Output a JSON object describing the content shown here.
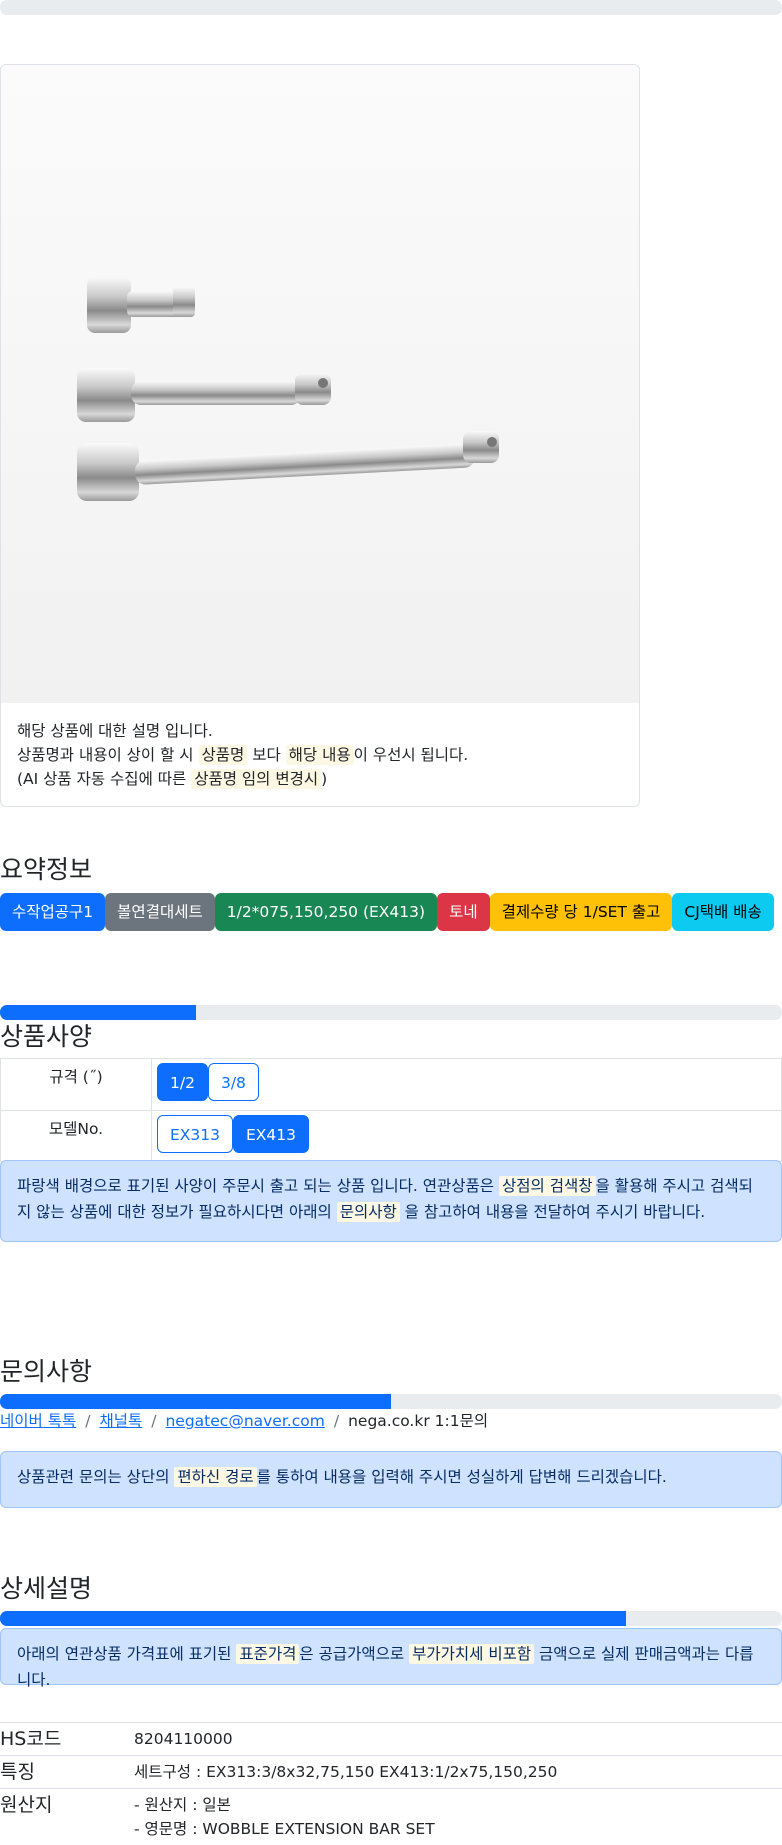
{
  "top_progress": {
    "fill_fraction": 0.0
  },
  "product_card": {
    "image_alt": "wobble extension bar set photo",
    "desc_line1": "해당 상품에 대한 설명 입니다.",
    "desc_line2_a": "상품명과 내용이 상이 할 시 ",
    "desc_line2_mark1": "상품명",
    "desc_line2_b": " 보다 ",
    "desc_line2_mark2": "해당 내용",
    "desc_line2_c": "이 우선시 됩니다.",
    "desc_line3_a": "(AI 상품 자동 수집에 따른 ",
    "desc_line3_mark": "상품명 임의 변경시",
    "desc_line3_b": ")"
  },
  "summary": {
    "title": "요약정보",
    "badges": [
      {
        "label": "수작업공구1",
        "bg": "#0d6efd",
        "fg": "#ffffff"
      },
      {
        "label": "볼연결대세트",
        "bg": "#6c757d",
        "fg": "#ffffff"
      },
      {
        "label": "1/2*075,150,250 (EX413)",
        "bg": "#198754",
        "fg": "#ffffff"
      },
      {
        "label": "토네",
        "bg": "#dc3545",
        "fg": "#ffffff"
      },
      {
        "label": "결제수량 당 1/SET 출고",
        "bg": "#ffc107",
        "fg": "#000000"
      },
      {
        "label": "CJ택배 배송",
        "bg": "#0dcaf0",
        "fg": "#000000"
      }
    ]
  },
  "spec": {
    "progress_fraction": 0.25,
    "title": "상품사양",
    "rows": [
      {
        "label": "규격 (˝)",
        "options": [
          {
            "label": "1/2",
            "selected": true
          },
          {
            "label": "3/8",
            "selected": false
          }
        ]
      },
      {
        "label": "모델No.",
        "options": [
          {
            "label": "EX313",
            "selected": false
          },
          {
            "label": "EX413",
            "selected": true
          }
        ]
      }
    ],
    "notice_a": "파랑색 배경으로 표기된 사양이 주문시 출고 되는 상품 입니다. 연관상품은 ",
    "notice_mark1": "상점의 검색창",
    "notice_b": "을 활용해 주시고 검색되지 않는 상품에 대한 정보가 필요하시다면 아래의 ",
    "notice_mark2": "문의사항",
    "notice_c": " 을 참고하여 내용을 전달하여 주시기 바랍니다."
  },
  "inquiry": {
    "title": "문의사항",
    "progress_fraction": 0.5,
    "links": [
      "네이버 톡톡",
      "채널톡",
      "negatec@naver.com"
    ],
    "plain": "nega.co.kr 1:1문의",
    "separator": "/",
    "notice_a": "상품관련 문의는 상단의 ",
    "notice_mark": "편하신 경로",
    "notice_b": "를 통하여 내용을 입력해 주시면 성실하게 답변해 드리겠습니다."
  },
  "detail": {
    "title": "상세설명",
    "progress_fraction": 0.8,
    "notice_a": "아래의 연관상품 가격표에 표기된 ",
    "notice_mark1": "표준가격",
    "notice_b": "은 공급가액으로 ",
    "notice_mark2": "부가가치세 비포함",
    "notice_c": " 금액으로 실제 판매금액과는 다릅니다.",
    "rows": [
      {
        "key": "HS코드",
        "lines": [
          "8204110000"
        ]
      },
      {
        "key": "특징",
        "lines": [
          "세트구성 : EX313:3/8x32,75,150 EX413:1/2x75,150,250"
        ]
      },
      {
        "key": "원산지",
        "lines": [
          "- 원산지 : 일본",
          "- 영문명 : WOBBLE EXTENSION BAR SET"
        ]
      }
    ]
  }
}
